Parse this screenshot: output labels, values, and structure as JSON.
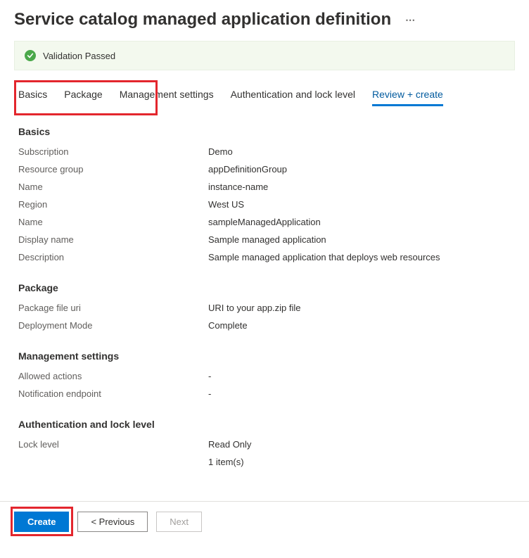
{
  "header": {
    "title": "Service catalog managed application definition"
  },
  "validation": {
    "message": "Validation Passed"
  },
  "tabs": {
    "basics": "Basics",
    "package": "Package",
    "management": "Management settings",
    "auth": "Authentication and lock level",
    "review": "Review + create"
  },
  "sections": {
    "basics": {
      "title": "Basics",
      "subscription_label": "Subscription",
      "subscription_value": "Demo",
      "rg_label": "Resource group",
      "rg_value": "appDefinitionGroup",
      "name1_label": "Name",
      "name1_value": "instance-name",
      "region_label": "Region",
      "region_value": "West US",
      "name2_label": "Name",
      "name2_value": "sampleManagedApplication",
      "display_label": "Display name",
      "display_value": "Sample managed application",
      "desc_label": "Description",
      "desc_value": "Sample managed application that deploys web resources"
    },
    "package": {
      "title": "Package",
      "fileuri_label": "Package file uri",
      "fileuri_value": "URI to your app.zip file",
      "mode_label": "Deployment Mode",
      "mode_value": "Complete"
    },
    "mgmt": {
      "title": "Management settings",
      "allowed_label": "Allowed actions",
      "allowed_value": "-",
      "notif_label": "Notification endpoint",
      "notif_value": "-"
    },
    "auth": {
      "title": "Authentication and lock level",
      "lock_label": "Lock level",
      "lock_value": "Read Only",
      "items_label": "",
      "items_value": "1 item(s)"
    }
  },
  "footer": {
    "create": "Create",
    "previous": "< Previous",
    "next": "Next"
  }
}
